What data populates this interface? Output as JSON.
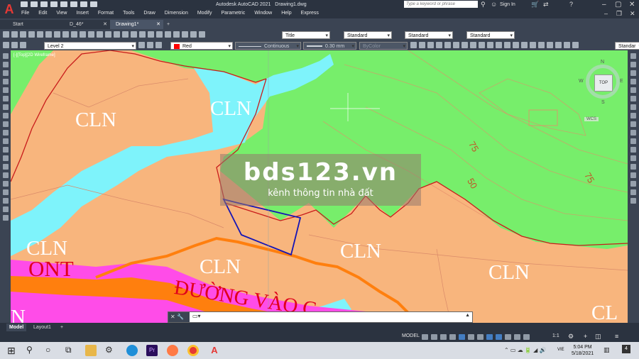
{
  "app": {
    "name": "Autodesk AutoCAD 2021",
    "file": "Drawing1.dwg",
    "search_placeholder": "Type a keyword or phrase",
    "signin": "Sign In"
  },
  "menu": [
    "File",
    "Edit",
    "View",
    "Insert",
    "Format",
    "Tools",
    "Draw",
    "Dimension",
    "Modify",
    "Parametric",
    "Window",
    "Help",
    "Express"
  ],
  "tabs": [
    {
      "label": "Start",
      "active": false
    },
    {
      "label": "D_46*",
      "active": false
    },
    {
      "label": "Drawing1*",
      "active": true
    }
  ],
  "toolbar1": {
    "text_style": "Title",
    "dim_style": "Standard",
    "table_style": "Standard",
    "mleader_style": "Standard"
  },
  "toolbar2": {
    "layer": "Level 2",
    "color": "Red",
    "color_hex": "#ff0000",
    "linetype": "Continuous",
    "lineweight": "0.30 mm",
    "plotstyle": "ByColor",
    "right_style": "Standar"
  },
  "viewport": {
    "label": "[-][Top][2D Wireframe]",
    "viewcube": {
      "top": "TOP",
      "n": "N",
      "s": "S",
      "e": "E",
      "w": "W",
      "wcs": "WCS"
    }
  },
  "map": {
    "colors": {
      "cln": "#f8b57d",
      "river": "#7ef3fb",
      "forest": "#77ee6b",
      "ont": "#ff4ce8",
      "road": "#ff7f0e",
      "boundary": "#c81b1b",
      "parcel": "#1515b5"
    },
    "labels": {
      "cln": [
        "CLN",
        "CLN",
        "CLN",
        "CLN",
        "CLN",
        "CLN"
      ],
      "ont": "ONT",
      "road": "ĐƯỜNG VÀO C",
      "n_partial": "N",
      "cl_partial": "CL",
      "contour_75a": "75",
      "contour_50": "50",
      "contour_75b": "75"
    }
  },
  "watermark": {
    "title": "bds123.vn",
    "subtitle": "kênh thông tin nhà đất"
  },
  "layout_tabs": [
    {
      "label": "Model",
      "active": true
    },
    {
      "label": "Layout1",
      "active": false
    }
  ],
  "status": {
    "model": "MODEL",
    "scale": "1:1"
  },
  "taskbar": {
    "time": "5:04 PM",
    "date": "5/18/2021",
    "lang": "VIE",
    "notify_count": "4"
  }
}
